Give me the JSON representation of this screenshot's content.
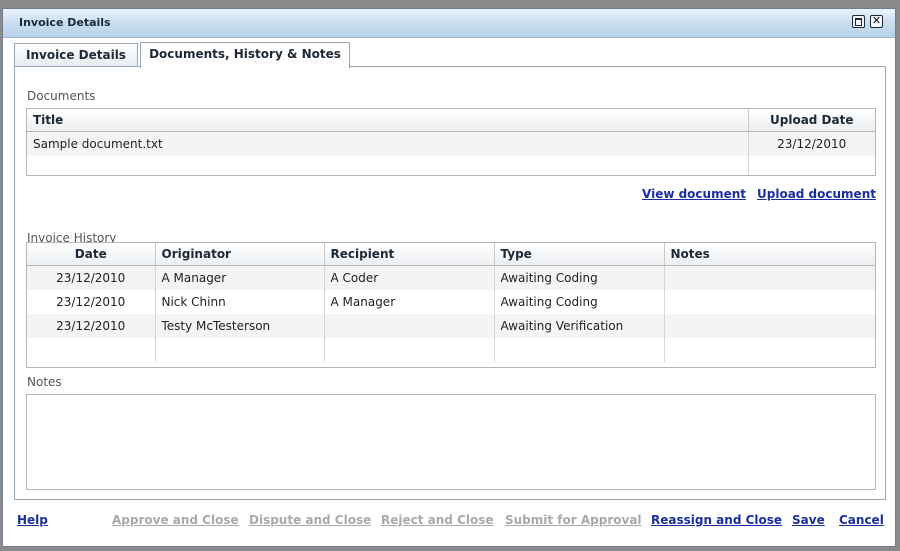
{
  "window": {
    "title": "Invoice Details"
  },
  "tabs": [
    {
      "label": "Invoice Details",
      "active": false
    },
    {
      "label": "Documents, History & Notes",
      "active": true
    }
  ],
  "documents": {
    "label": "Documents",
    "columns": [
      "Title",
      "Upload Date"
    ],
    "rows": [
      {
        "title": "Sample document.txt",
        "upload_date": "23/12/2010"
      }
    ],
    "actions": {
      "view": "View document",
      "upload": "Upload document"
    }
  },
  "history": {
    "label": "Invoice History",
    "columns": [
      "Date",
      "Originator",
      "Recipient",
      "Type",
      "Notes"
    ],
    "rows": [
      {
        "date": "23/12/2010",
        "originator": "A Manager",
        "recipient": "A Coder",
        "type": "Awaiting Coding",
        "notes": ""
      },
      {
        "date": "23/12/2010",
        "originator": "Nick Chinn",
        "recipient": "A Manager",
        "type": "Awaiting Coding",
        "notes": ""
      },
      {
        "date": "23/12/2010",
        "originator": "Testy McTesterson",
        "recipient": "",
        "type": "Awaiting Verification",
        "notes": ""
      }
    ]
  },
  "notes": {
    "label": "Notes",
    "value": ""
  },
  "footer": {
    "help": "Help",
    "approve": "Approve and Close",
    "dispute": "Dispute and Close",
    "reject": "Reject and Close",
    "submit": "Submit for Approval",
    "reassign": "Reassign and Close",
    "save": "Save",
    "cancel": "Cancel"
  },
  "colors": {
    "link": "#1a2f9e",
    "disabled_link": "#a9a9a9",
    "titlebar": "#c6dcef"
  }
}
